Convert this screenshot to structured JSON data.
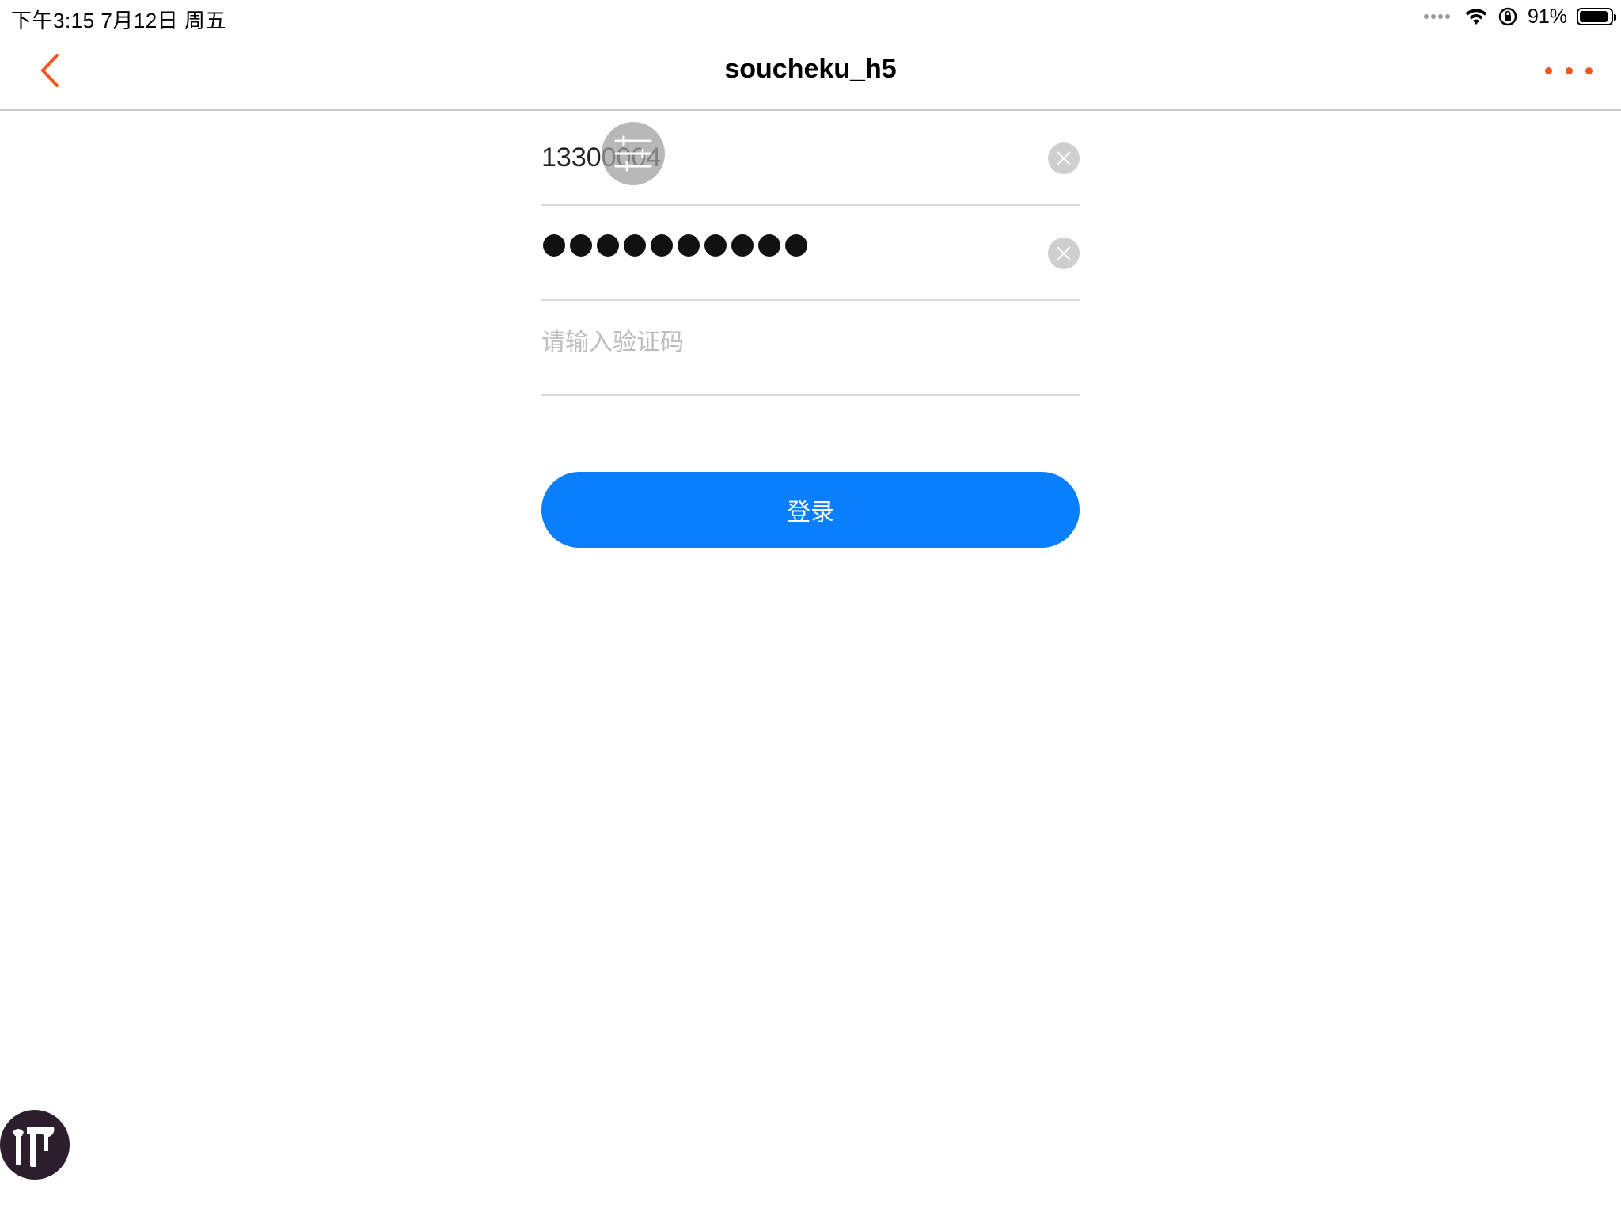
{
  "status_bar": {
    "time_date": "下午3:15   7月12日 周五",
    "battery_percent": "91%",
    "battery_level": 0.91,
    "icons": [
      "signal-dots-icon",
      "wifi-icon",
      "orientation-lock-icon",
      "battery-icon"
    ]
  },
  "nav": {
    "title": "soucheku_h5",
    "back_icon": "chevron-left-icon",
    "more_icon": "ellipsis-icon"
  },
  "form": {
    "phone_value": "13300004",
    "password_mask_count": 10,
    "code_placeholder": "请输入验证码",
    "clear_icon": "clear-icon"
  },
  "login_button": {
    "label": "登录"
  },
  "overlay": {
    "assistive_icon": "sliders-icon",
    "badge_icon": "tools-icon"
  },
  "colors": {
    "accent_orange": "#f0561e",
    "primary_blue": "#0a7ffe",
    "clear_grey": "#cfcfcf",
    "divider": "#d8d8d8"
  }
}
